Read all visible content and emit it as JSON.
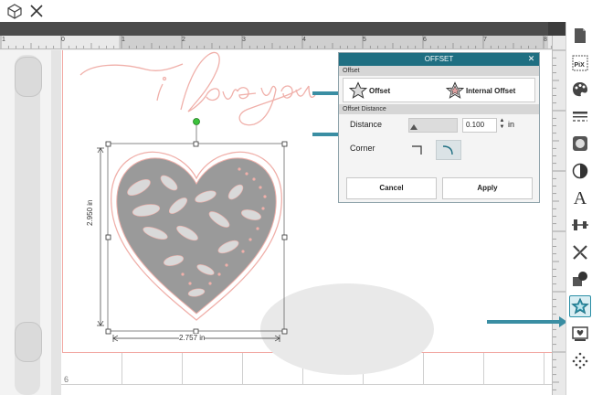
{
  "toolbar": {
    "icons": [
      "cube-icon",
      "close-icon"
    ]
  },
  "rulers": {
    "top_numbers": [
      "1",
      "0",
      "1",
      "2",
      "3",
      "4",
      "5",
      "6",
      "7",
      "8"
    ],
    "left_page_number": "6"
  },
  "canvas": {
    "script_text": "i love you",
    "height_dimension": "2.950 in",
    "width_dimension": "2.757 in"
  },
  "dialog": {
    "title": "OFFSET",
    "section_offset": "Offset",
    "option_offset": "Offset",
    "option_internal": "Internal Offset",
    "section_distance": "Offset Distance",
    "distance_label": "Distance",
    "distance_value": "0.100",
    "distance_unit": "in",
    "corner_label": "Corner",
    "cancel_label": "Cancel",
    "apply_label": "Apply",
    "selected_option": "Offset",
    "selected_corner": "round"
  },
  "tools": {
    "items": [
      "page-setup-icon",
      "pixscan-icon",
      "fill-icon",
      "line-style-icon",
      "trace-icon",
      "transparency-icon",
      "text-icon",
      "align-icon",
      "replicate-icon",
      "modify-icon",
      "offset-icon",
      "library-icon",
      "dots-icon"
    ],
    "active": "offset-icon",
    "text_tool_glyph": "A"
  },
  "colors": {
    "accent": "#1f6f82",
    "arrow": "#3a8ea3",
    "cutline": "#f2a7a2",
    "heart_fill": "#9a9a9a"
  }
}
